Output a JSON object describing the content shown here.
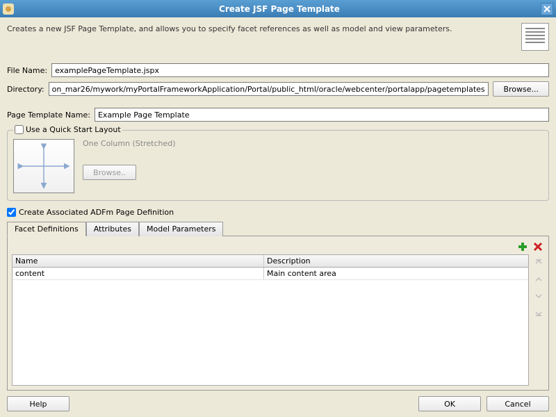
{
  "title": "Create JSF Page Template",
  "description": "Creates a new JSF Page Template, and allows you to specify facet references as well as model and view parameters.",
  "labels": {
    "file_name": "File Name:",
    "directory": "Directory:",
    "browse": "Browse...",
    "page_template_name": "Page Template Name:",
    "quick_start_legend": "Use a Quick Start Layout",
    "layout_name": "One Column (Stretched)",
    "layout_browse": "Browse..",
    "adfm_checkbox": "Create Associated ADFm Page Definition",
    "tabs": {
      "facet": "Facet Definitions",
      "attributes": "Attributes",
      "model": "Model Parameters"
    },
    "columns": {
      "name": "Name",
      "description": "Description"
    },
    "footer": {
      "help": "Help",
      "ok": "OK",
      "cancel": "Cancel"
    }
  },
  "values": {
    "file_name": "examplePageTemplate.jspx",
    "directory": "on_mar26/mywork/myPortalFrameworkApplication/Portal/public_html/oracle/webcenter/portalapp/pagetemplates",
    "page_template_name": "Example Page Template",
    "quick_start_checked": false,
    "adfm_checked": true
  },
  "facets": [
    {
      "name": "content",
      "description": "Main content area"
    }
  ]
}
